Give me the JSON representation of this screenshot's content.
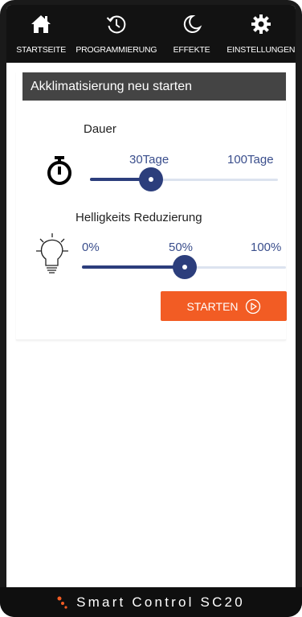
{
  "nav": {
    "items": [
      {
        "label": "STARTSEITE",
        "icon": "home-icon"
      },
      {
        "label": "PROGRAMMIERUNG",
        "icon": "history-icon"
      },
      {
        "label": "EFFEKTE",
        "icon": "moon-icon"
      },
      {
        "label": "EINSTELLUNGEN",
        "icon": "gear-icon"
      }
    ]
  },
  "panel": {
    "title": "Akklimatisierung neu starten",
    "duration": {
      "label": "Dauer",
      "icon": "stopwatch-icon",
      "value_label": "30Tage",
      "max_label": "100Tage",
      "value": 30,
      "max": 100
    },
    "brightness": {
      "label": "Helligkeits Reduzierung",
      "icon": "lightbulb-icon",
      "min_label": "0%",
      "value_label": "50%",
      "max_label": "100%",
      "value": 50
    },
    "start_button": {
      "label": "STARTEN",
      "icon": "play-circle-icon"
    }
  },
  "footer": {
    "brand": "Smart Control SC20",
    "logo_icon": "dots-logo-icon",
    "colors": {
      "accent": "#f25c24",
      "slider": "#2c3e7c"
    }
  }
}
